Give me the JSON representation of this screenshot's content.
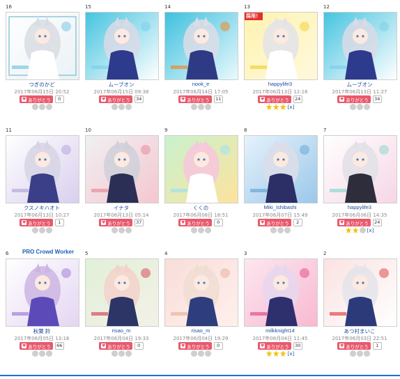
{
  "labels": {
    "thanks": "ありがとう",
    "adopted_badge": "採用！",
    "feedback_link": "[x]",
    "pro_badge": "PRO Crowd Worker"
  },
  "colors": {
    "link": "#1a4fa0",
    "thanks_button": "#e9596c",
    "star_on": "#f1c40f",
    "star_off": "#cfcfcf",
    "adopted": "#e3322e",
    "pro": "#1a5fb4"
  },
  "entries": [
    {
      "num": "16",
      "name": "つぎのかど",
      "date": "2017年06月15日 20:52",
      "count": "0",
      "rating": 0,
      "feedback": false,
      "adopted": false,
      "pro": false,
      "art": "sketch"
    },
    {
      "num": "15",
      "name": "ムーブオン",
      "date": "2017年06月15日 09:38",
      "count": "34",
      "rating": 0,
      "feedback": false,
      "adopted": false,
      "pro": false,
      "art": "cyan"
    },
    {
      "num": "14",
      "name": "nook_e",
      "date": "2017年06月14日 17:05",
      "count": "11",
      "rating": 0,
      "feedback": false,
      "adopted": false,
      "pro": false,
      "art": "cyan-text"
    },
    {
      "num": "13",
      "name": "happylife3",
      "date": "2017年06月13日 12:18",
      "count": "24",
      "rating": 3,
      "feedback": true,
      "adopted": true,
      "pro": false,
      "art": "yellow"
    },
    {
      "num": "12",
      "name": "ムーブオン",
      "date": "2017年06月13日 11:27",
      "count": "34",
      "rating": 0,
      "feedback": false,
      "adopted": false,
      "pro": false,
      "art": "cyan"
    },
    {
      "num": "11",
      "name": "クスノキハオト",
      "date": "2017年06月13日 10:27",
      "count": "1",
      "rating": 0,
      "feedback": false,
      "adopted": false,
      "pro": false,
      "art": "lavender"
    },
    {
      "num": "10",
      "name": "イナタ",
      "date": "2017年06月13日 05:14",
      "count": "37",
      "rating": 0,
      "feedback": false,
      "adopted": false,
      "pro": false,
      "art": "gray"
    },
    {
      "num": "9",
      "name": "くくの",
      "date": "2017年06月08日 18:51",
      "count": "0",
      "rating": 0,
      "feedback": false,
      "adopted": false,
      "pro": false,
      "art": "rainbow"
    },
    {
      "num": "8",
      "name": "Miki_Ishibashi",
      "date": "2017年06月07日 15:49",
      "count": "2",
      "rating": 0,
      "feedback": false,
      "adopted": false,
      "pro": false,
      "art": "blue"
    },
    {
      "num": "7",
      "name": "happylife3",
      "date": "2017年06月06日 14:35",
      "count": "24",
      "rating": 2,
      "feedback": true,
      "adopted": false,
      "pro": false,
      "art": "pastel"
    },
    {
      "num": "6",
      "name": "秋葉 鈴",
      "date": "2017年06月05日 13:16",
      "count": "66",
      "rating": 0,
      "feedback": false,
      "adopted": false,
      "pro": true,
      "art": "purple"
    },
    {
      "num": "5",
      "name": "risao_m",
      "date": "2017年06月04日 19:33",
      "count": "0",
      "rating": 0,
      "feedback": false,
      "adopted": false,
      "pro": false,
      "art": "green"
    },
    {
      "num": "4",
      "name": "risao_m",
      "date": "2017年06月04日 19:29",
      "count": "0",
      "rating": 0,
      "feedback": false,
      "adopted": false,
      "pro": false,
      "art": "peach"
    },
    {
      "num": "3",
      "name": "milkknight14",
      "date": "2017年06月04日 11:45",
      "count": "30",
      "rating": 3,
      "feedback": true,
      "adopted": false,
      "pro": false,
      "art": "pink"
    },
    {
      "num": "2",
      "name": "あつ村まいこ",
      "date": "2017年06月03日 22:51",
      "count": "1",
      "rating": 0,
      "feedback": false,
      "adopted": false,
      "pro": false,
      "art": "red"
    }
  ]
}
